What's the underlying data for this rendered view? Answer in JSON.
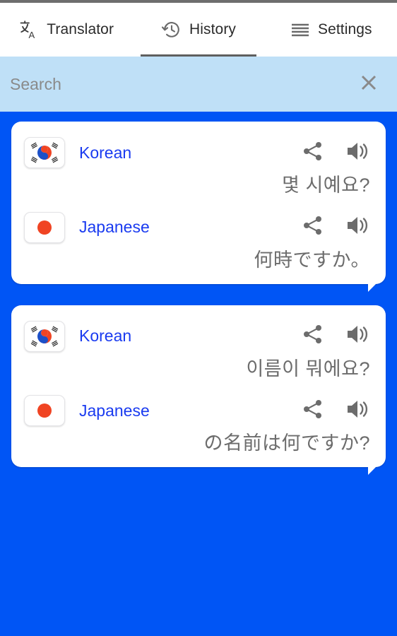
{
  "app": {
    "background_color": "#0055f5",
    "card_background": "#ffffff",
    "accent_blue": "#1a3bf0",
    "search_background": "#bfe0f7",
    "phrase_color": "#6c6c6c"
  },
  "tabs": [
    {
      "label": "Translator",
      "icon": "translate-icon",
      "active": false
    },
    {
      "label": "History",
      "icon": "history-clock-icon",
      "active": true
    },
    {
      "label": "Settings",
      "icon": "hamburger-menu-icon",
      "active": false
    }
  ],
  "search": {
    "value": "",
    "placeholder": "Search",
    "close_icon": "close-x-icon"
  },
  "history": {
    "cards": [
      {
        "source": {
          "flag": "korean-flag-icon",
          "language": "Korean",
          "text": "몇 시예요?",
          "share_icon": "share-icon",
          "speak_icon": "speaker-icon"
        },
        "target": {
          "flag": "japanese-flag-icon",
          "language": "Japanese",
          "text": "何時ですか。",
          "share_icon": "share-icon",
          "speak_icon": "speaker-icon"
        }
      },
      {
        "source": {
          "flag": "korean-flag-icon",
          "language": "Korean",
          "text": "이름이 뭐에요?",
          "share_icon": "share-icon",
          "speak_icon": "speaker-icon"
        },
        "target": {
          "flag": "japanese-flag-icon",
          "language": "Japanese",
          "text": "の名前は何ですか?",
          "share_icon": "share-icon",
          "speak_icon": "speaker-icon"
        }
      }
    ]
  }
}
